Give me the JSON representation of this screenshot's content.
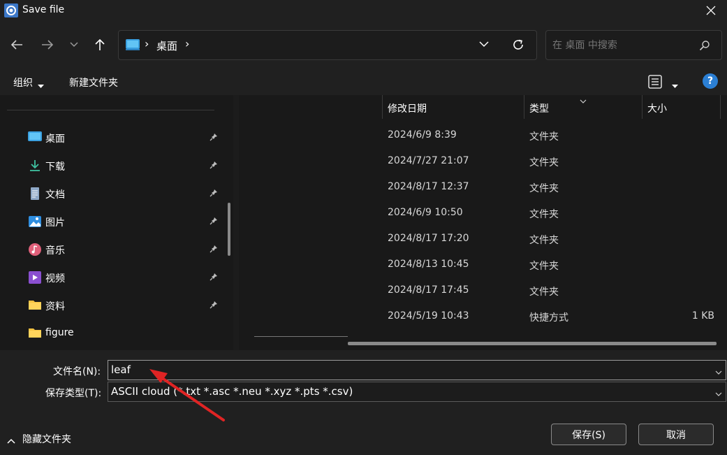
{
  "window": {
    "title": "Save file"
  },
  "address": {
    "crumb": "桌面",
    "sep": "›"
  },
  "search": {
    "placeholder": "在 桌面 中搜索"
  },
  "toolbar": {
    "organize": "组织",
    "new_folder": "新建文件夹",
    "help": "?"
  },
  "sidebar": {
    "items": [
      {
        "label": "桌面",
        "icon": "desktop-icon",
        "pinned": true
      },
      {
        "label": "下载",
        "icon": "download-icon",
        "pinned": true
      },
      {
        "label": "文档",
        "icon": "document-icon",
        "pinned": true
      },
      {
        "label": "图片",
        "icon": "picture-icon",
        "pinned": true
      },
      {
        "label": "音乐",
        "icon": "music-icon",
        "pinned": true
      },
      {
        "label": "视频",
        "icon": "video-icon",
        "pinned": true
      },
      {
        "label": "资料",
        "icon": "folder-icon",
        "pinned": true
      },
      {
        "label": "figure",
        "icon": "folder-icon",
        "pinned": false
      }
    ]
  },
  "columns": {
    "date": "修改日期",
    "type": "类型",
    "size": "大小"
  },
  "rows": [
    {
      "date": "2024/6/9 8:39",
      "type": "文件夹",
      "size": ""
    },
    {
      "date": "2024/7/27 21:07",
      "type": "文件夹",
      "size": ""
    },
    {
      "date": "2024/8/17 12:37",
      "type": "文件夹",
      "size": ""
    },
    {
      "date": "2024/6/9 10:50",
      "type": "文件夹",
      "size": ""
    },
    {
      "date": "2024/8/17 17:20",
      "type": "文件夹",
      "size": ""
    },
    {
      "date": "2024/8/13 10:45",
      "type": "文件夹",
      "size": ""
    },
    {
      "date": "2024/8/17 17:45",
      "type": "文件夹",
      "size": ""
    },
    {
      "date": "2024/5/19 10:43",
      "type": "快捷方式",
      "size": "1 KB"
    }
  ],
  "form": {
    "filename_label": "文件名(N):",
    "filename_value": "leaf",
    "filetype_label": "保存类型(T):",
    "filetype_value": "ASCII cloud (*.txt *.asc *.neu *.xyz *.pts *.csv)"
  },
  "buttons": {
    "save": "保存(S)",
    "cancel": "取消",
    "hide_folders": "隐藏文件夹"
  },
  "colors": {
    "accent": "#2b7fd4",
    "annotation_arrow": "#e02424",
    "background": "#191919"
  }
}
